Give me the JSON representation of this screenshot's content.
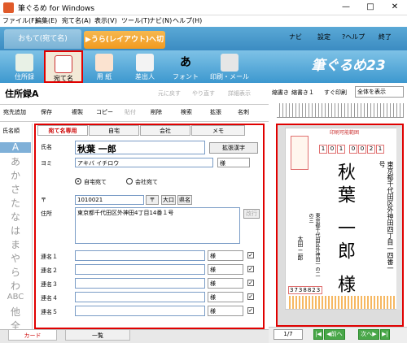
{
  "window": {
    "title": "筆ぐるめ for Windows"
  },
  "menu": [
    "ファイル(F)",
    "編集(E)",
    "宛て名(A)",
    "表示(V)",
    "ツール(T)",
    "ナビ(N)",
    "ヘルプ(H)"
  ],
  "mode": {
    "front": "おもて(宛て名)",
    "back": "▶うら(レイアウト)へ切替",
    "navi": "ナビ",
    "settings": "設定",
    "help": "?ヘルプ",
    "exit": "終了"
  },
  "tools": [
    "住所録",
    "宛て名",
    "用 紙",
    "差出人",
    "フォント",
    "印刷・メール"
  ],
  "logo": "筆ぐるめ23",
  "addressbook": {
    "title": "住所録A",
    "prev": "元に戻す",
    "redo": "やり直す",
    "detail": "詳細表示"
  },
  "subtools": [
    "宛先追加",
    "保存",
    "複製",
    "コピー",
    "貼付",
    "削除",
    "検索",
    "拡張",
    "名刺"
  ],
  "namesort": {
    "label": "氏名順",
    "kana": [
      "A",
      "あ",
      "か",
      "さ",
      "た",
      "な",
      "は",
      "ま",
      "や",
      "ら",
      "わ",
      "ABC",
      "他",
      "全"
    ]
  },
  "formtabs": [
    "宛て名専用",
    "自宅",
    "会社",
    "メモ"
  ],
  "form": {
    "name_label": "氏名",
    "name_value": "秋葉 一郎",
    "extend_kanji": "拡張漢字",
    "yomi_label": "ヨミ",
    "yomi_value": "アキバ イチロウ",
    "honorific": "様",
    "addr_home": "自宅宛て",
    "addr_company": "会社宛て",
    "zip_label": "〒",
    "zip_value": "1010021",
    "zip_btn": "〒",
    "oguchi": "大口",
    "ken": "県名",
    "address_label": "住所",
    "address_value": "東京都千代田区外神田4丁目14番１号",
    "newline": "改行",
    "joint_labels": [
      "連名１",
      "連名２",
      "連名３",
      "連名４",
      "連名５"
    ],
    "joint_honorific": "様"
  },
  "bottomtabs": {
    "card": "カード",
    "list": "一覧"
  },
  "preview": {
    "shrink": "縮書き",
    "shrink1": "縮書き１",
    "print_now": "すぐ印刷",
    "view": "全体を表示",
    "print_area": "印刷可能範囲",
    "zip": [
      "1",
      "0",
      "1",
      "0",
      "0",
      "2",
      "1"
    ],
    "name": "秋葉 一郎 様",
    "address": "東京都千代田区外神田四丁目一四番一号",
    "sender": "東京都千代田区外神田一の二の三",
    "sender_name": "太田 二郎",
    "sender_zip": "3738823"
  },
  "pager": {
    "page": "1/7",
    "prev": "◀前へ",
    "next": "次へ▶"
  },
  "colors": {
    "accent": "#3d98cf",
    "highlight": "#e00000",
    "orange": "#f29a1f"
  }
}
